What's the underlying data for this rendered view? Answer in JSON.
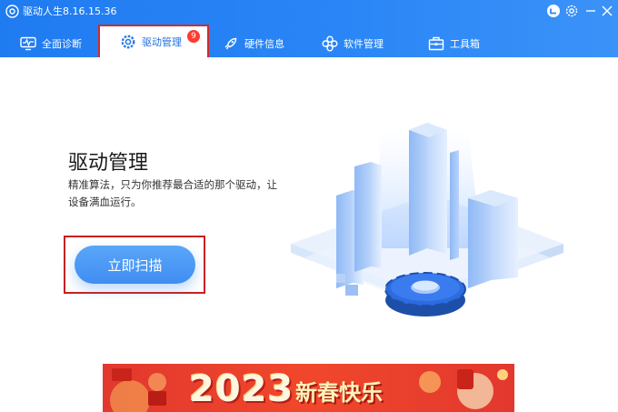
{
  "window": {
    "title": "驱动人生8.16.15.36"
  },
  "tabs": [
    {
      "label": "全面诊断"
    },
    {
      "label": "驱动管理",
      "badge": "9"
    },
    {
      "label": "硬件信息"
    },
    {
      "label": "软件管理"
    },
    {
      "label": "工具箱"
    }
  ],
  "main": {
    "title": "驱动管理",
    "description": "精准算法，只为你推荐最合适的那个驱动，让设备满血运行。",
    "scan_button": "立即扫描"
  },
  "banner": {
    "year": "2023",
    "text": "新春快乐"
  },
  "colors": {
    "brand_blue": "#2a86f6",
    "highlight_red": "#c62222"
  }
}
